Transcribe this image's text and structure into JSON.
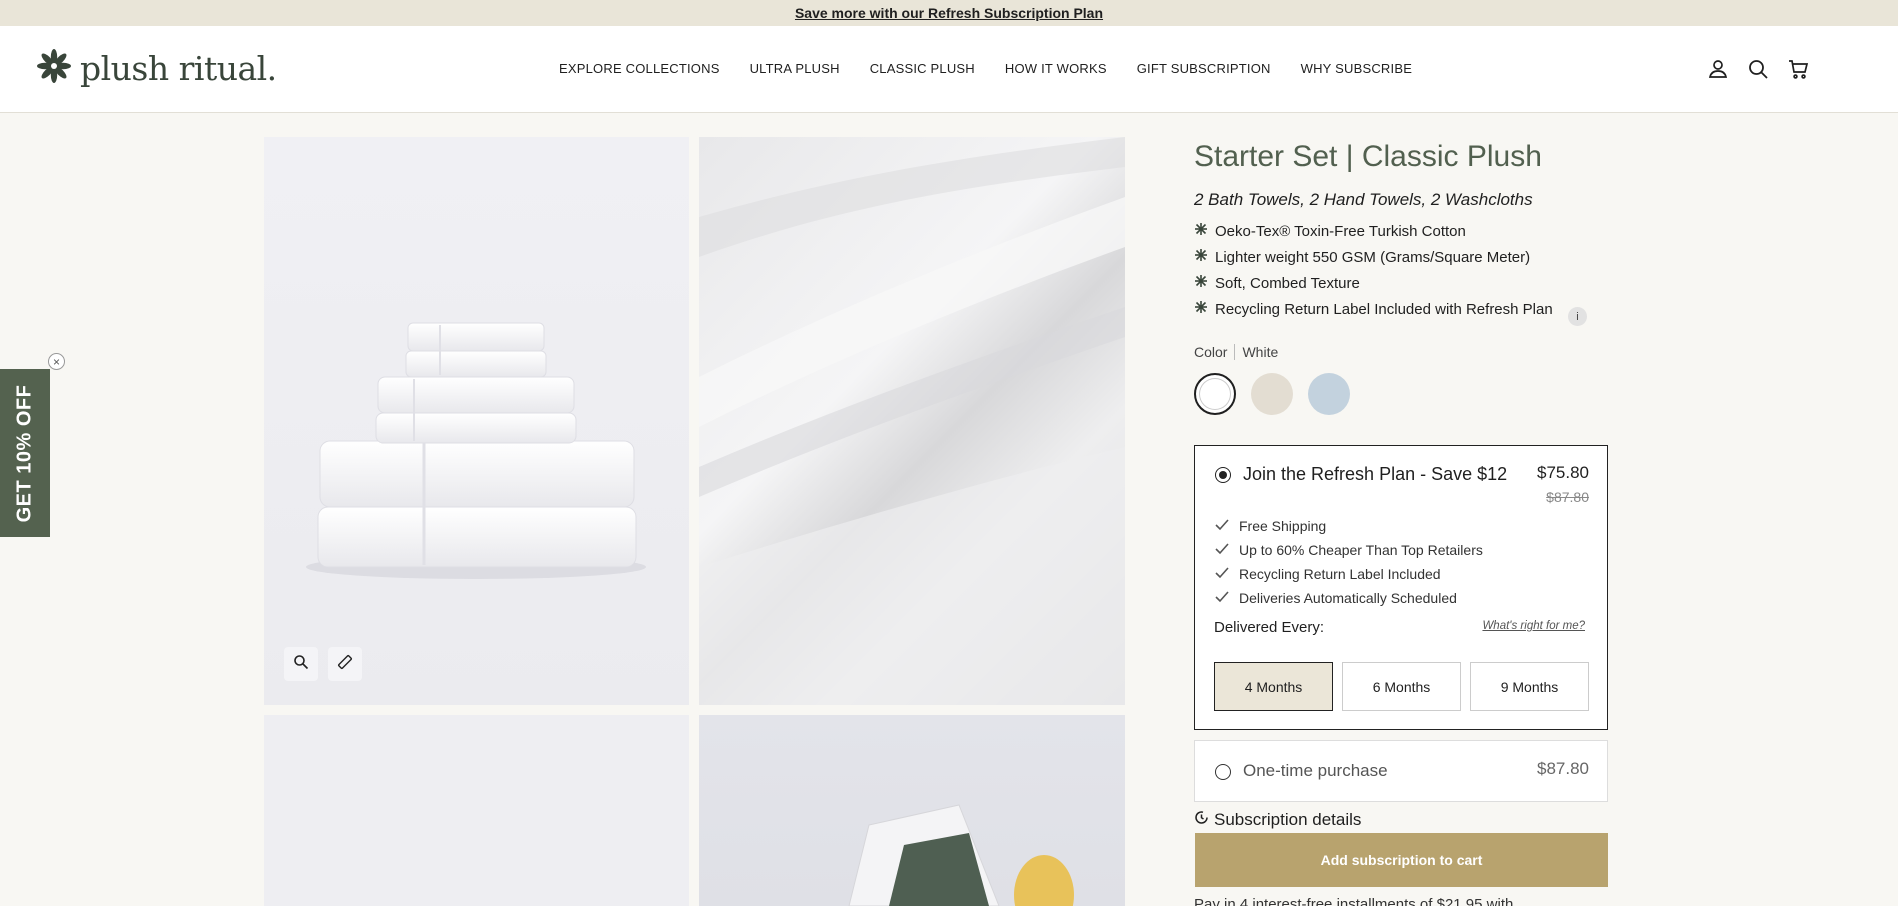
{
  "announcement": {
    "text": "Save more with our Refresh Subscription Plan"
  },
  "header": {
    "logo_text": "plush ritual.",
    "nav": [
      {
        "label": "EXPLORE COLLECTIONS"
      },
      {
        "label": "ULTRA PLUSH"
      },
      {
        "label": "CLASSIC PLUSH"
      },
      {
        "label": "HOW IT WORKS"
      },
      {
        "label": "GIFT SUBSCRIPTION"
      },
      {
        "label": "WHY SUBSCRIBE"
      }
    ],
    "icons": [
      "account-icon",
      "search-icon",
      "cart-icon"
    ]
  },
  "side_tab": {
    "label": "GET 10% OFF",
    "close": "×"
  },
  "product": {
    "title": "Starter Set | Classic Plush",
    "subtitle": "2 Bath Towels, 2 Hand Towels, 2 Washcloths",
    "features": [
      "Oeko-Tex® Toxin-Free Turkish Cotton",
      "Lighter weight 550 GSM (Grams/Square Meter)",
      "Soft, Combed Texture",
      "Recycling Return Label Included with Refresh Plan"
    ],
    "info_icon": "i",
    "color_label": "Color",
    "color_value": "White",
    "swatches": [
      {
        "name": "White",
        "color": "#ffffff",
        "selected": true
      },
      {
        "name": "Sand",
        "color": "#e3ddd2",
        "selected": false
      },
      {
        "name": "Blue",
        "color": "#c3d2de",
        "selected": false
      }
    ]
  },
  "plan": {
    "label": "Join the Refresh Plan - Save $12",
    "price": "$75.80",
    "old_price": "$87.80",
    "benefits": [
      "Free Shipping",
      "Up to 60% Cheaper Than Top Retailers",
      "Recycling Return Label Included",
      "Deliveries Automatically Scheduled"
    ],
    "delivered_label": "Delivered Every:",
    "whats_right": "What's right for me?",
    "frequencies": [
      {
        "label": "4 Months",
        "selected": true
      },
      {
        "label": "6 Months",
        "selected": false
      },
      {
        "label": "9 Months",
        "selected": false
      }
    ]
  },
  "onetime": {
    "label": "One-time purchase",
    "price": "$87.80"
  },
  "subscription_details": "Subscription details",
  "add_button": "Add subscription to cart",
  "klarna_text": "Pay in 4 interest-free installments of $21.95 with"
}
